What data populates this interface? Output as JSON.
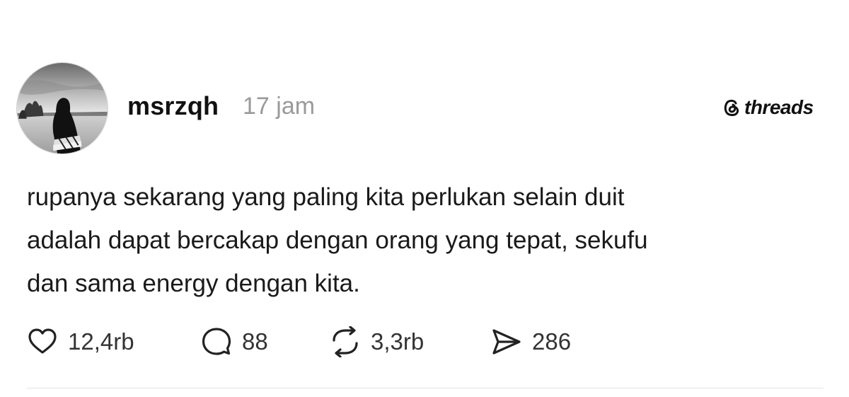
{
  "post": {
    "username": "msrzqh",
    "timestamp": "17 jam",
    "brand": "threads",
    "text_lines": [
      "rupanya sekarang yang paling kita perlukan selain duit",
      "adalah dapat bercakap dengan orang yang tepat, sekufu",
      "dan sama energy dengan kita."
    ]
  },
  "actions": {
    "like": {
      "icon": "heart-icon",
      "count": "12,4rb"
    },
    "comment": {
      "icon": "speech-bubble-icon",
      "count": "88"
    },
    "repost": {
      "icon": "repost-arrows-icon",
      "count": "3,3rb"
    },
    "share": {
      "icon": "send-icon",
      "count": "286"
    }
  },
  "colors": {
    "text": "#1a1a1a",
    "muted": "#9a9a9a",
    "background": "#ffffff",
    "divider": "#e4e4e4"
  }
}
